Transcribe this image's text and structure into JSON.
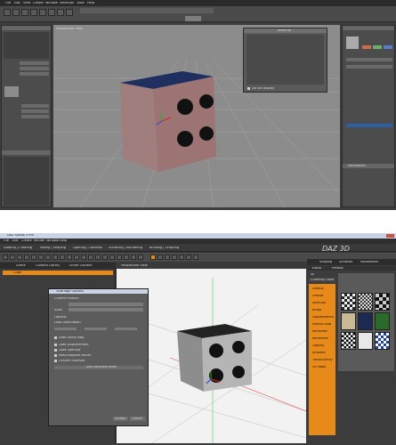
{
  "colors": {
    "accent_orange": "#e88a1a",
    "bg_dark": "#3c3c3c",
    "viewport": "#8a8a8a",
    "cube_top": "#1f3060",
    "selection_blue": "#2d5fa5"
  },
  "top": {
    "menubar": [
      "File",
      "Edit",
      "View",
      "Create",
      "Window",
      "Selection",
      "Tools",
      "Help"
    ],
    "dialog_title": "About ss",
    "dialog_footer_label": "Do not display",
    "viewport_title": "Perspective View",
    "bottom_panel_title": "Parameters"
  },
  "bottom": {
    "window_title": "DAZ Studio 4 Pro",
    "menubar": [
      "File",
      "Edit",
      "Create",
      "Render",
      "Window",
      "Help"
    ],
    "tabs": [
      "Loading | Creating",
      "Posing | Shaping",
      "Lighting | Cameras",
      "Surfacing | Rendering",
      "Building | Scripting"
    ],
    "logo": "DAZ 3D",
    "left_tabs": [
      "Scene",
      "Content Library",
      "Smart Content"
    ],
    "scene_item": "Cube",
    "viewport_label": "Perspective View",
    "right_tabs": [
      "Shaping",
      "Surfaces",
      "Parameters"
    ],
    "surface_sub_tabs": [
      "Editor",
      "Presets"
    ],
    "surface_filter": "All",
    "surface_item": "Currently Used",
    "surface_list": [
      "Default",
      "Diffuse",
      "Specular",
      "Bump",
      "Displacement",
      "Normal Map",
      "Reflection",
      "Refraction",
      "Opacity",
      "Ambient",
      "Translucency",
      "UV Maps"
    ],
    "dialog": {
      "title": "3DBridge Options",
      "rows": [
        "Current Product",
        "Scale",
        "Options",
        "Load Destination",
        "Load Bump Map",
        "Load Displacement",
        "Load Specular",
        "Read Mapped Values",
        "Convert Normals",
        "Add Selected Items"
      ],
      "buttons": [
        "Accept",
        "Cancel"
      ]
    }
  }
}
